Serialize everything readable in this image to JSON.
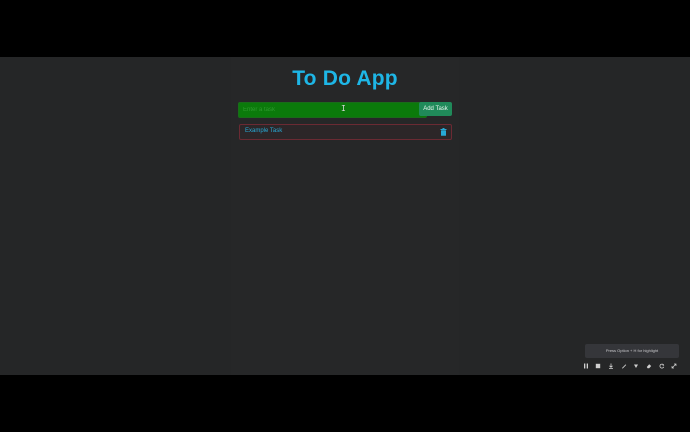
{
  "app": {
    "title": "To Do App"
  },
  "form": {
    "input_placeholder": "Enter a task",
    "input_value": "",
    "add_button_label": "Add Task"
  },
  "tasks": [
    {
      "label": "Example Task"
    }
  ],
  "recorder": {
    "hint_text": "Press Option + H for highlight",
    "icons": [
      "pause-icon",
      "stop-icon",
      "download-icon",
      "pen-icon",
      "arrow-down-icon",
      "eraser-icon",
      "refresh-icon",
      "expand-icon"
    ]
  },
  "colors": {
    "background": "#252627",
    "title": "#1eb6e6",
    "input_bg": "#0b7a0b",
    "add_button_bg": "#208a5a",
    "task_border": "#6b2a33",
    "task_text": "#27a9d6"
  }
}
